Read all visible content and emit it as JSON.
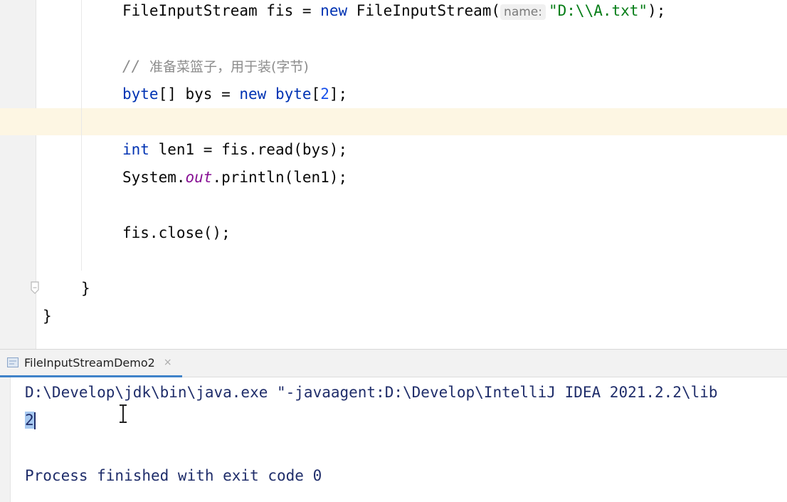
{
  "editor": {
    "lines": {
      "fis_type": "FileInputStream",
      "fis_var": " fis = ",
      "new1": "new",
      "fis_ctor": " FileInputStream(",
      "hint_name": "name:",
      "path_string": "\"D:\\\\A.txt\"",
      "fis_end": ");",
      "comment_slashes": "// ",
      "comment_text": "准备菜篮子，用于装(字节)",
      "byte_kw": "byte",
      "bys_decl": "[] bys = ",
      "new2": "new",
      "byte_kw2": " byte",
      "arr_open": "[",
      "arr_size": "2",
      "arr_close": "];",
      "int_kw": "int",
      "len_stmt": " len1 = fis.read(bys);",
      "sys_prefix": "System.",
      "out_field": "out",
      "println_stmt": ".println(len1);",
      "close_stmt": "fis.close();",
      "brace_method": "}",
      "brace_class": "}"
    }
  },
  "run_panel": {
    "tab_label": "FileInputStreamDemo2",
    "tab_close": "×",
    "console": {
      "command": "D:\\Develop\\jdk\\bin\\java.exe \"-javaagent:D:\\Develop\\IntelliJ IDEA 2021.2.2\\lib",
      "output_value": "2",
      "exit_message": "Process finished with exit code 0"
    }
  },
  "icons": {
    "fold": "fold-end-icon",
    "tab": "run-config-icon",
    "cursor": "text-cursor-icon"
  },
  "colors": {
    "keyword": "#0033b3",
    "string": "#067d17",
    "number": "#1750eb",
    "comment": "#8c8c8c",
    "static_field": "#871094",
    "tab_underline": "#4083c9",
    "selection": "#a6c8f0"
  }
}
